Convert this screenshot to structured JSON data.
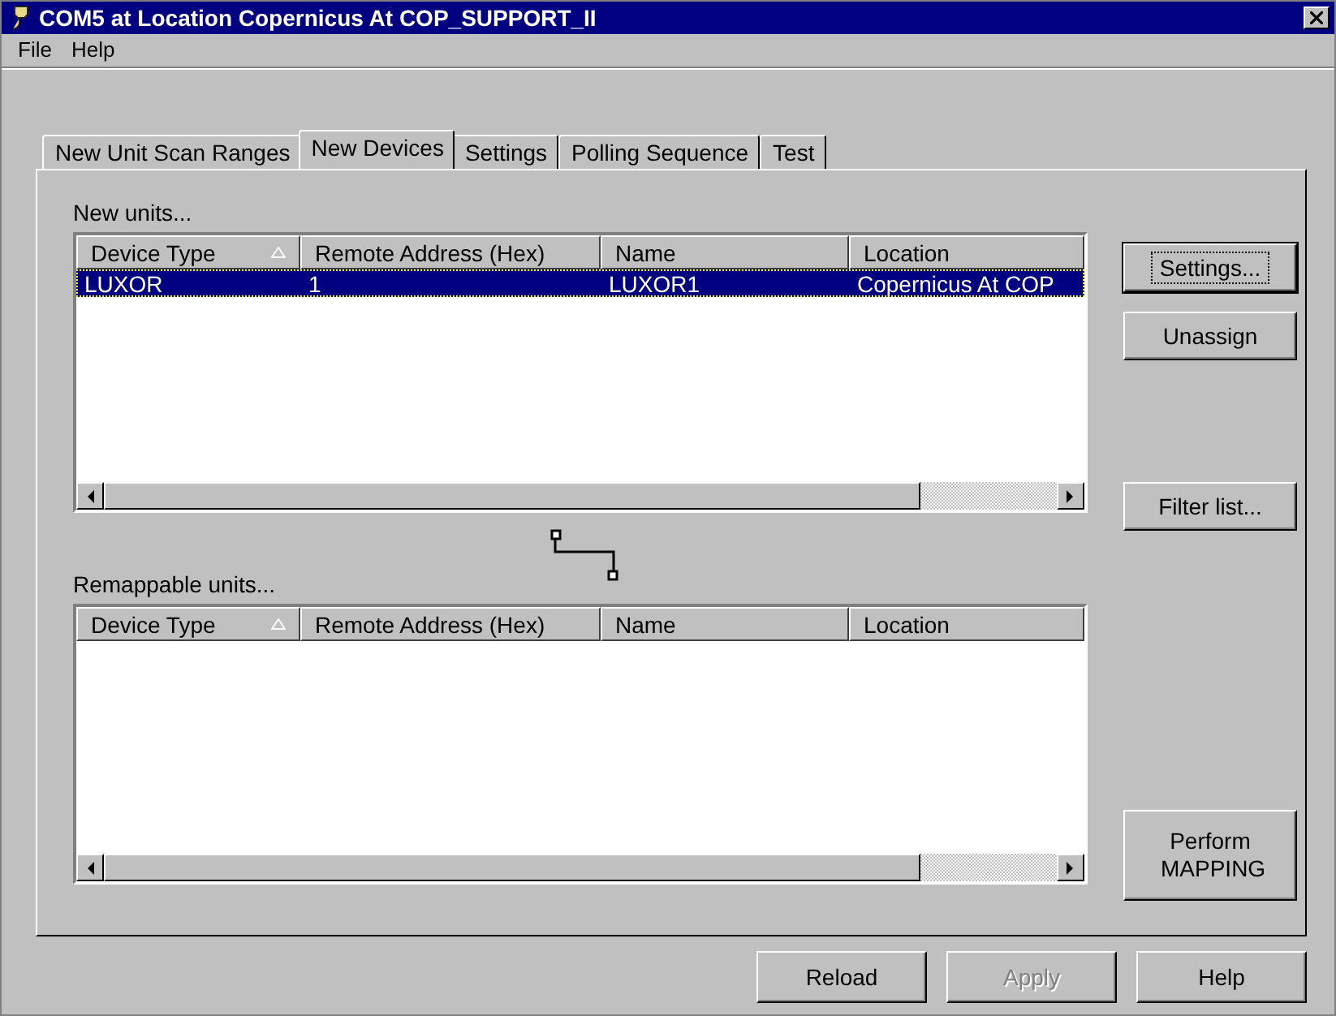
{
  "window": {
    "title": "COM5 at Location Copernicus At COP_SUPPORT_II"
  },
  "menu": [
    "File",
    "Help"
  ],
  "tabs": [
    {
      "label": "New Unit Scan Ranges",
      "selected": false
    },
    {
      "label": "New Devices",
      "selected": true
    },
    {
      "label": "Settings",
      "selected": false
    },
    {
      "label": "Polling Sequence",
      "selected": false
    },
    {
      "label": "Test",
      "selected": false
    }
  ],
  "new_units": {
    "label": "New units...",
    "columns": [
      {
        "label": "Device Type",
        "sorted": true
      },
      {
        "label": "Remote Address (Hex)",
        "sorted": false
      },
      {
        "label": "Name",
        "sorted": false
      },
      {
        "label": "Location",
        "sorted": false
      }
    ],
    "rows": [
      {
        "cells": [
          "LUXOR",
          "1",
          "LUXOR1",
          "Copernicus At COP"
        ],
        "selected": true
      }
    ]
  },
  "remappable_units": {
    "label": "Remappable units...",
    "columns": [
      {
        "label": "Device Type",
        "sorted": true
      },
      {
        "label": "Remote Address (Hex)",
        "sorted": false
      },
      {
        "label": "Name",
        "sorted": false
      },
      {
        "label": "Location",
        "sorted": false
      }
    ]
  },
  "side_buttons": [
    {
      "label": "Settings...",
      "kind": "default"
    },
    {
      "label": "Unassign",
      "kind": "normal"
    },
    {
      "label": "Filter list...",
      "kind": "normal"
    },
    {
      "label": "Perform MAPPING",
      "kind": "tall"
    }
  ],
  "bottom_buttons": [
    {
      "label": "Reload",
      "disabled": false
    },
    {
      "label": "Apply",
      "disabled": true
    },
    {
      "label": "Help",
      "disabled": false
    }
  ]
}
